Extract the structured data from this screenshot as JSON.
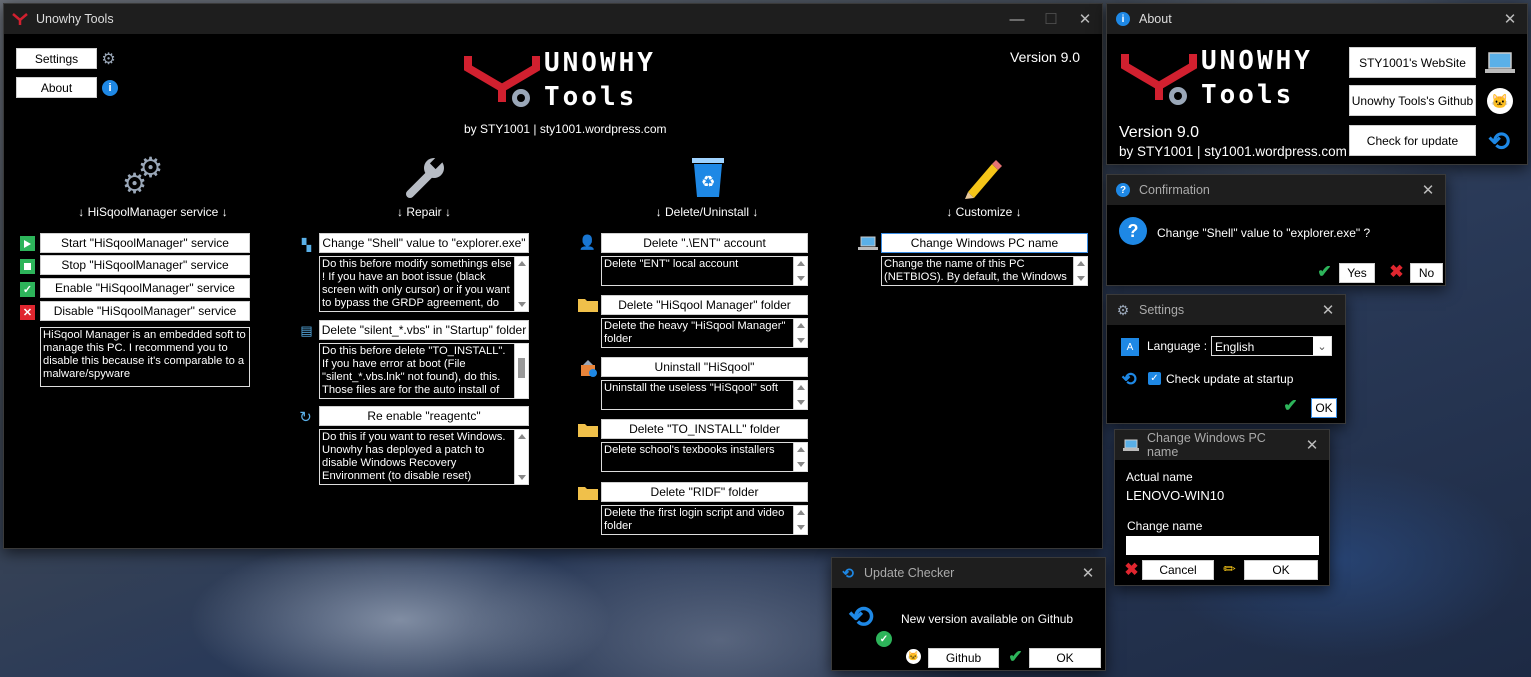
{
  "main": {
    "title": "Unowhy Tools",
    "settings_button": "Settings",
    "about_button": "About",
    "version": "Version 9.0",
    "byline": "by STY1001 | sty1001.wordpress.com",
    "logo_line1": "UNOWHY",
    "logo_line2": "Tools",
    "sections": {
      "service": {
        "header": "↓ HiSqoolManager service ↓",
        "start": "Start \"HiSqoolManager\" service",
        "stop": "Stop \"HiSqoolManager\" service",
        "enable": "Enable \"HiSqoolManager\" service",
        "disable": "Disable \"HiSqoolManager\" service",
        "desc": "HiSqool Manager is an embedded soft to manage this PC. I recommend you to disable this because it's comparable to a malware/spyware"
      },
      "repair": {
        "header": "↓ Repair ↓",
        "shell_button": "Change \"Shell\" value to \"explorer.exe\"",
        "shell_desc": "Do this before modify somethings else ! If you have an boot issue (black screen with only cursor) or if you want to bypass the GRDP agreement, do this",
        "silent_button": "Delete \"silent_*.vbs\" in \"Startup\" folder",
        "silent_desc": "Do this before delete \"TO_INSTALL\". If you have error at boot (File \"silent_*.vbs.lnk\" not found), do this. Those files are for the auto install of",
        "reagentc_button": "Re enable \"reagentc\"",
        "reagentc_desc": "Do this if you want to reset Windows. Unowhy has deployed a patch to disable Windows Recovery Environment (to disable reset)"
      },
      "delete": {
        "header": "↓ Delete/Uninstall ↓",
        "ent_button": "Delete \".\\ENT\" account",
        "ent_desc": "Delete \"ENT\" local account",
        "hsm_button": "Delete \"HiSqool Manager\" folder",
        "hsm_desc": "Delete the heavy \"HiSqool Manager\" folder",
        "uninstall_button": "Uninstall \"HiSqool\"",
        "uninstall_desc": "Uninstall the useless \"HiSqool\" soft",
        "toinstall_button": "Delete \"TO_INSTALL\" folder",
        "toinstall_desc": "Delete school's texbooks installers",
        "ridf_button": "Delete \"RIDF\" folder",
        "ridf_desc": "Delete the first login script and video folder"
      },
      "customize": {
        "header": "↓ Customize ↓",
        "pcname_button": "Change Windows PC name",
        "pcname_desc": "Change the name of this PC (NETBIOS). By default, the Windows"
      }
    }
  },
  "about": {
    "title": "About",
    "version": "Version 9.0",
    "byline": "by STY1001 | sty1001.wordpress.com",
    "website_button": "STY1001's WebSite",
    "github_button": "Unowhy Tools's Github",
    "update_button": "Check for update"
  },
  "confirmation": {
    "title": "Confirmation",
    "message": "Change \"Shell\" value to \"explorer.exe\" ?",
    "yes": "Yes",
    "no": "No"
  },
  "settings": {
    "title": "Settings",
    "language_label": "Language :",
    "language_value": "English",
    "update_check_label": "Check update at startup",
    "update_check_checked": true,
    "ok": "OK"
  },
  "pcname": {
    "title": "Change Windows PC name",
    "actual_label": "Actual name",
    "actual_value": "LENOVO-WIN10",
    "change_label": "Change name",
    "change_value": "",
    "cancel": "Cancel",
    "ok": "OK"
  },
  "updater": {
    "title": "Update Checker",
    "message": "New version available on Github",
    "github": "Github",
    "ok": "OK"
  },
  "colors": {
    "accent_red": "#d1202f",
    "ok_green": "#2db45a",
    "cancel_red": "#e0262f",
    "info_blue": "#1e88e5"
  }
}
